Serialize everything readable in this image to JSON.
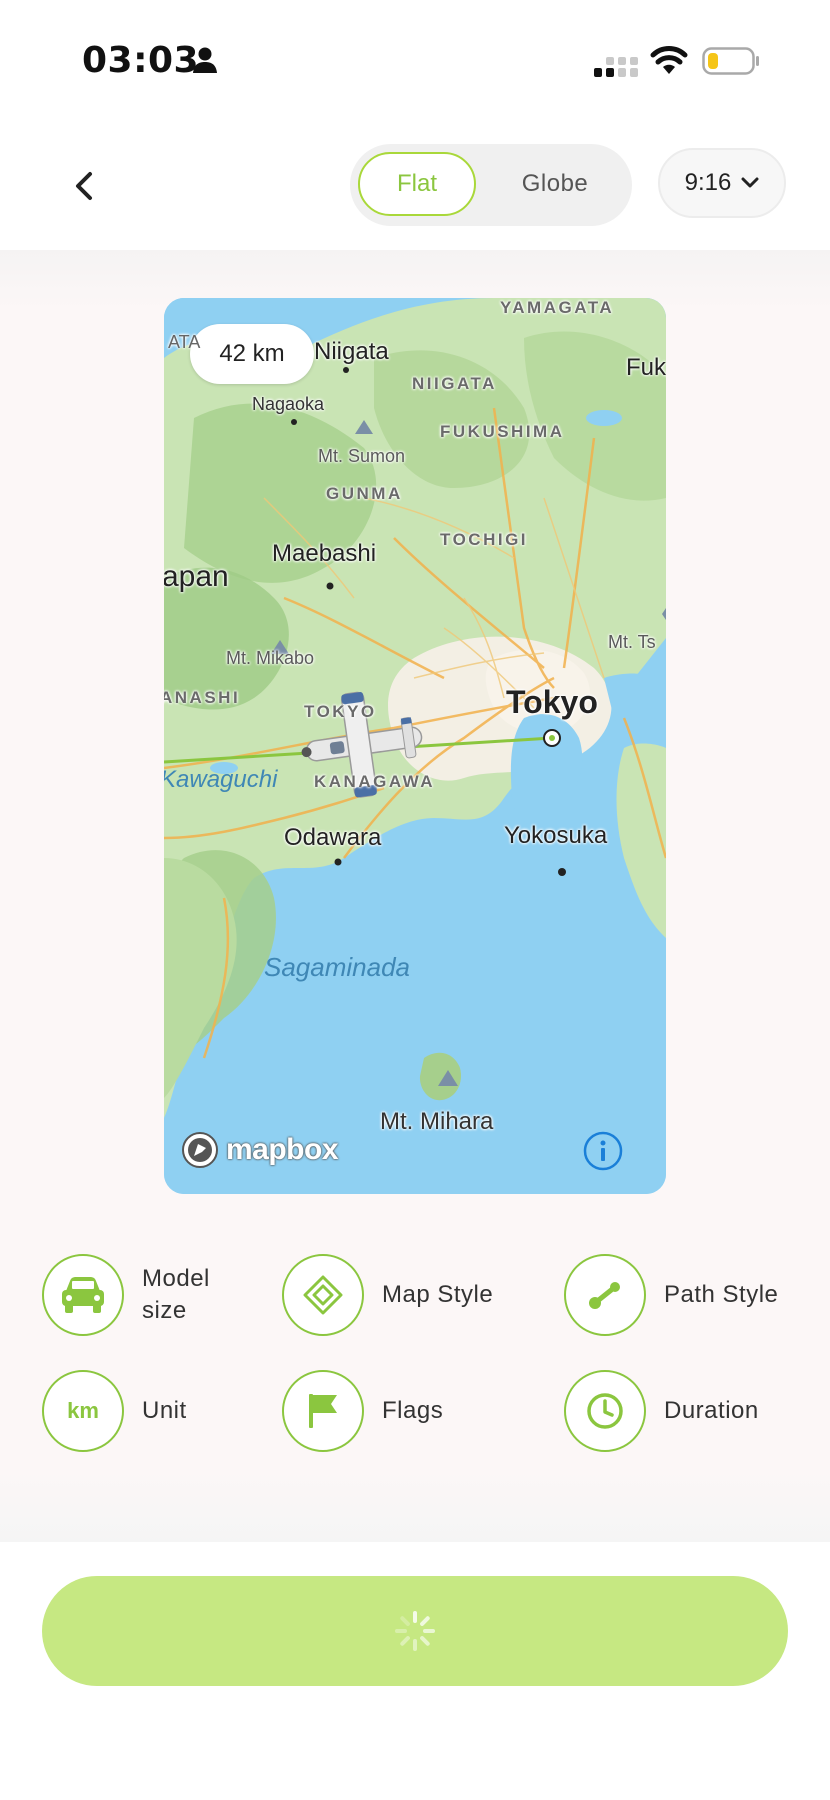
{
  "status_bar": {
    "time": "03:03",
    "icons": [
      "person-icon",
      "signal-icon",
      "wifi-icon",
      "battery-icon"
    ]
  },
  "header": {
    "back_icon": "chevron-left-icon",
    "view_toggle": {
      "options": [
        "Flat",
        "Globe"
      ],
      "selected": "Flat"
    },
    "aspect_ratio": {
      "value": "9:16",
      "icon": "chevron-down-icon"
    }
  },
  "map": {
    "distance": "42 km",
    "labels": {
      "yamagata": "YAMAGATA",
      "niigata_city": "Niigata",
      "fuk": "Fuk",
      "ata": "ATA",
      "nagaoka": "Nagaoka",
      "niigata_region": "NIIGATA",
      "fukushima": "FUKUSHIMA",
      "mt_sumon": "Mt. Sumon",
      "gunma": "GUNMA",
      "maebashi": "Maebashi",
      "tochigi": "TOCHIGI",
      "japan": "apan",
      "mt_ts": "Mt. Ts",
      "mt_mikabo": "Mt. Mikabo",
      "anashi": "ANASHI",
      "tokyo_region": "TOKYO",
      "tokyo": "Tokyo",
      "kawaguchi": "Kawaguchi",
      "kanagawa": "KANAGAWA",
      "odawara": "Odawara",
      "yokosuka": "Yokosuka",
      "sagaminada": "Sagaminada",
      "mt_mihara": "Mt. Mihara"
    },
    "attribution": "mapbox",
    "info_icon": "info-icon",
    "colors": {
      "water": "#8fd0f2",
      "land": "#c8e6b8",
      "path": "#8bc63f"
    }
  },
  "options": [
    {
      "id": "model-size",
      "label": "Model size",
      "icon": "car-icon"
    },
    {
      "id": "map-style",
      "label": "Map Style",
      "icon": "layers-icon"
    },
    {
      "id": "path-style",
      "label": "Path Style",
      "icon": "path-icon"
    },
    {
      "id": "unit",
      "label": "Unit",
      "icon_text": "km"
    },
    {
      "id": "flags",
      "label": "Flags",
      "icon": "flag-icon"
    },
    {
      "id": "duration",
      "label": "Duration",
      "icon": "clock-icon"
    }
  ],
  "primary_button": {
    "state": "loading",
    "icon": "spinner-icon",
    "color": "#c6e882"
  },
  "accent_color": "#8bc63f"
}
